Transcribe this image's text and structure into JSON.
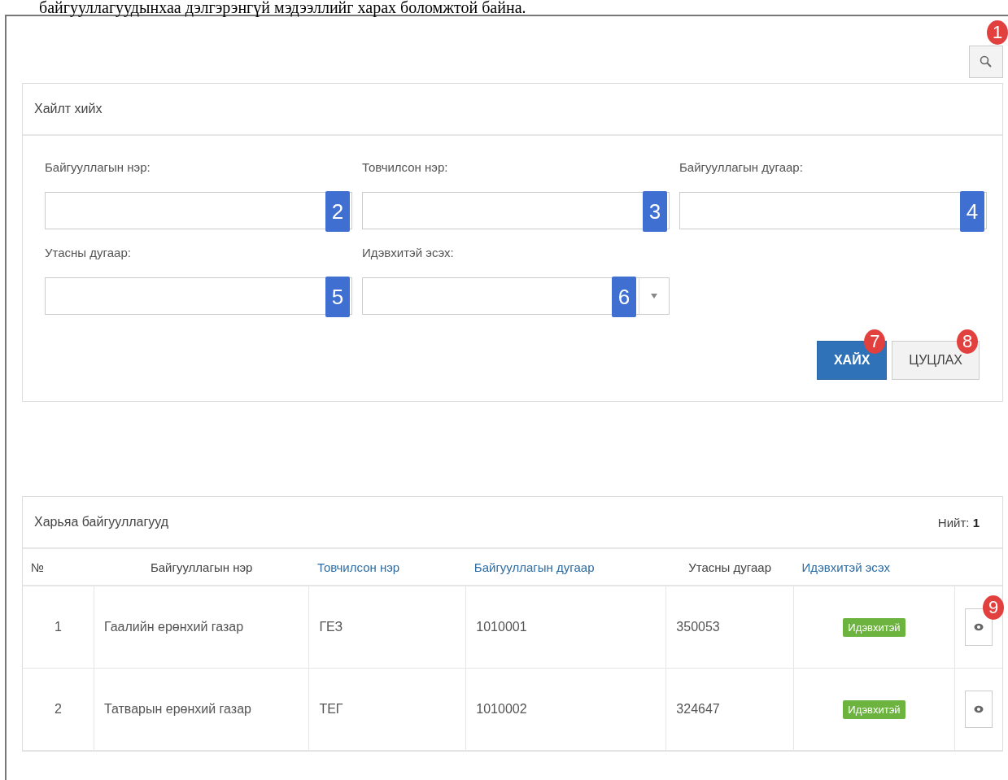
{
  "caption": "байгууллагуудынхаа дэлгэрэнгүй мэдээллийг харах боломжтой байна.",
  "search_toggle": {
    "marker": "1"
  },
  "search_panel": {
    "title": "Хайлт хийх",
    "fields": [
      {
        "label": "Байгууллагын нэр:",
        "kind": "text",
        "marker": "2"
      },
      {
        "label": "Товчилсон нэр:",
        "kind": "text",
        "marker": "3"
      },
      {
        "label": "Байгууллагын дугаар:",
        "kind": "text",
        "marker": "4"
      },
      {
        "label": "Утасны дугаар:",
        "kind": "text",
        "marker": "5"
      },
      {
        "label": "Идэвхитэй эсэх:",
        "kind": "select",
        "marker": "6"
      }
    ],
    "buttons": [
      {
        "label": "ХАЙХ",
        "kind": "primary",
        "marker": "7"
      },
      {
        "label": "ЦУЦЛАХ",
        "kind": "default",
        "marker": "8"
      }
    ]
  },
  "results": {
    "title": "Харьяа байгууллагууд",
    "total_label": "Нийт:",
    "total": "1",
    "columns": [
      {
        "label": "№",
        "sortable": false
      },
      {
        "label": "Байгууллагын нэр",
        "sortable": false
      },
      {
        "label": "Товчилсон нэр",
        "sortable": true
      },
      {
        "label": "Байгууллагын дугаар",
        "sortable": true
      },
      {
        "label": "Утасны дугаар",
        "sortable": false
      },
      {
        "label": "Идэвхитэй эсэх",
        "sortable": true
      }
    ],
    "rows": [
      {
        "no": "1",
        "name": "Гаалийн ерөнхий газар",
        "short": "ГЕЗ",
        "number": "1010001",
        "phone": "350053",
        "status": "Идэвхитэй",
        "marker": "9"
      },
      {
        "no": "2",
        "name": "Татварын ерөнхий газар",
        "short": "ТЕГ",
        "number": "1010002",
        "phone": "324647",
        "status": "Идэвхитэй"
      }
    ]
  }
}
